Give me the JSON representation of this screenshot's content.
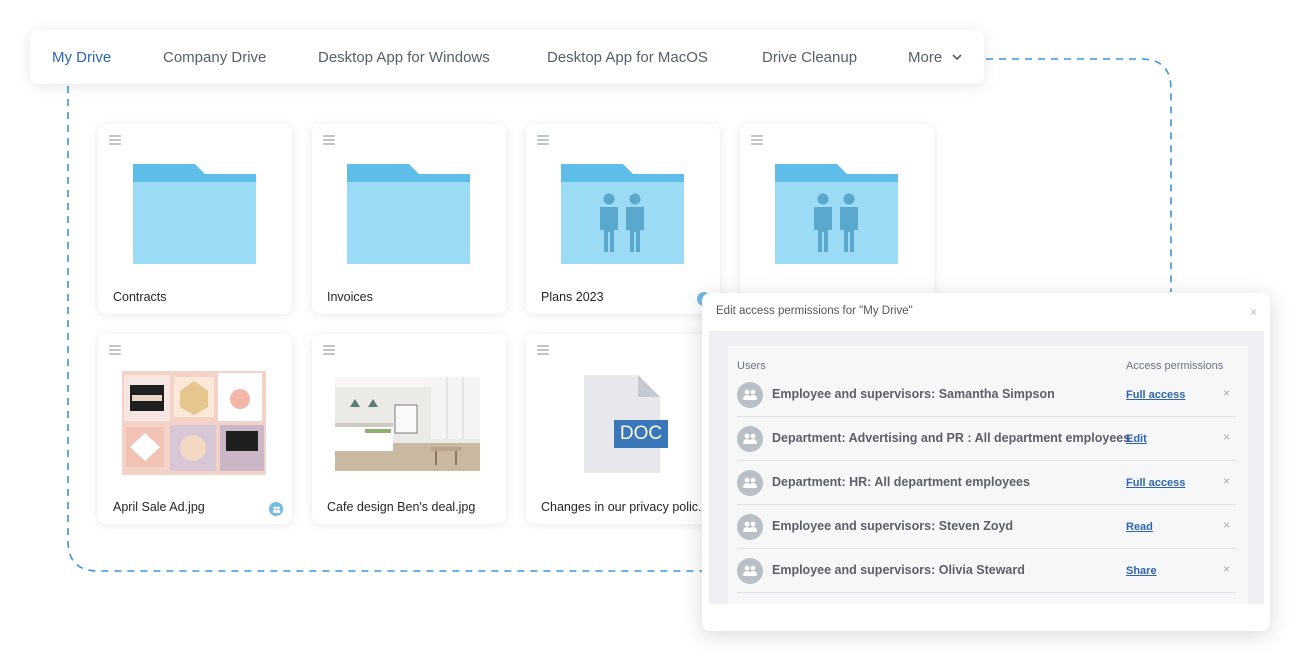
{
  "nav": {
    "items": [
      {
        "label": "My Drive",
        "active": true
      },
      {
        "label": "Company Drive"
      },
      {
        "label": "Desktop App for Windows"
      },
      {
        "label": "Desktop App for MacOS"
      },
      {
        "label": "Drive Cleanup"
      },
      {
        "label": "More"
      }
    ]
  },
  "tiles": [
    {
      "name": "Contracts",
      "kind": "folder-icon"
    },
    {
      "name": "Invoices",
      "kind": "folder-icon"
    },
    {
      "name": "Plans 2023",
      "kind": "shared-folder-icon"
    },
    {
      "name": "",
      "kind": "shared-folder-icon"
    },
    {
      "name": "April Sale Ad.jpg",
      "kind": "image-thumbnail",
      "shared": true
    },
    {
      "name": "Cafe design Ben's deal.jpg",
      "kind": "image-thumbnail"
    },
    {
      "name": "Changes in our privacy polic...",
      "kind": "doc-icon",
      "doc_label": "DOC"
    }
  ],
  "dialog": {
    "title": "Edit access permissions for \"My Drive\"",
    "close": "×",
    "headers": {
      "users": "Users",
      "access": "Access permissions"
    },
    "rows": [
      {
        "user": "Employee and supervisors: Samantha Simpson",
        "permission": "Full access"
      },
      {
        "user": "Department: Advertising and PR : All department employees",
        "permission": "Edit"
      },
      {
        "user": "Department: HR: All department employees",
        "permission": "Full access"
      },
      {
        "user": "Employee and supervisors: Steven Zoyd",
        "permission": "Read"
      },
      {
        "user": "Employee and supervisors: Olivia Steward",
        "permission": "Share"
      }
    ],
    "remove": "×"
  },
  "colors": {
    "accent": "#2a66b8",
    "folder": "#9bdbf5",
    "folder_tab": "#5fbde9",
    "people": "#5aa8cc",
    "dashed": "#3d95dd",
    "doc_badge": "#3a77b8"
  }
}
